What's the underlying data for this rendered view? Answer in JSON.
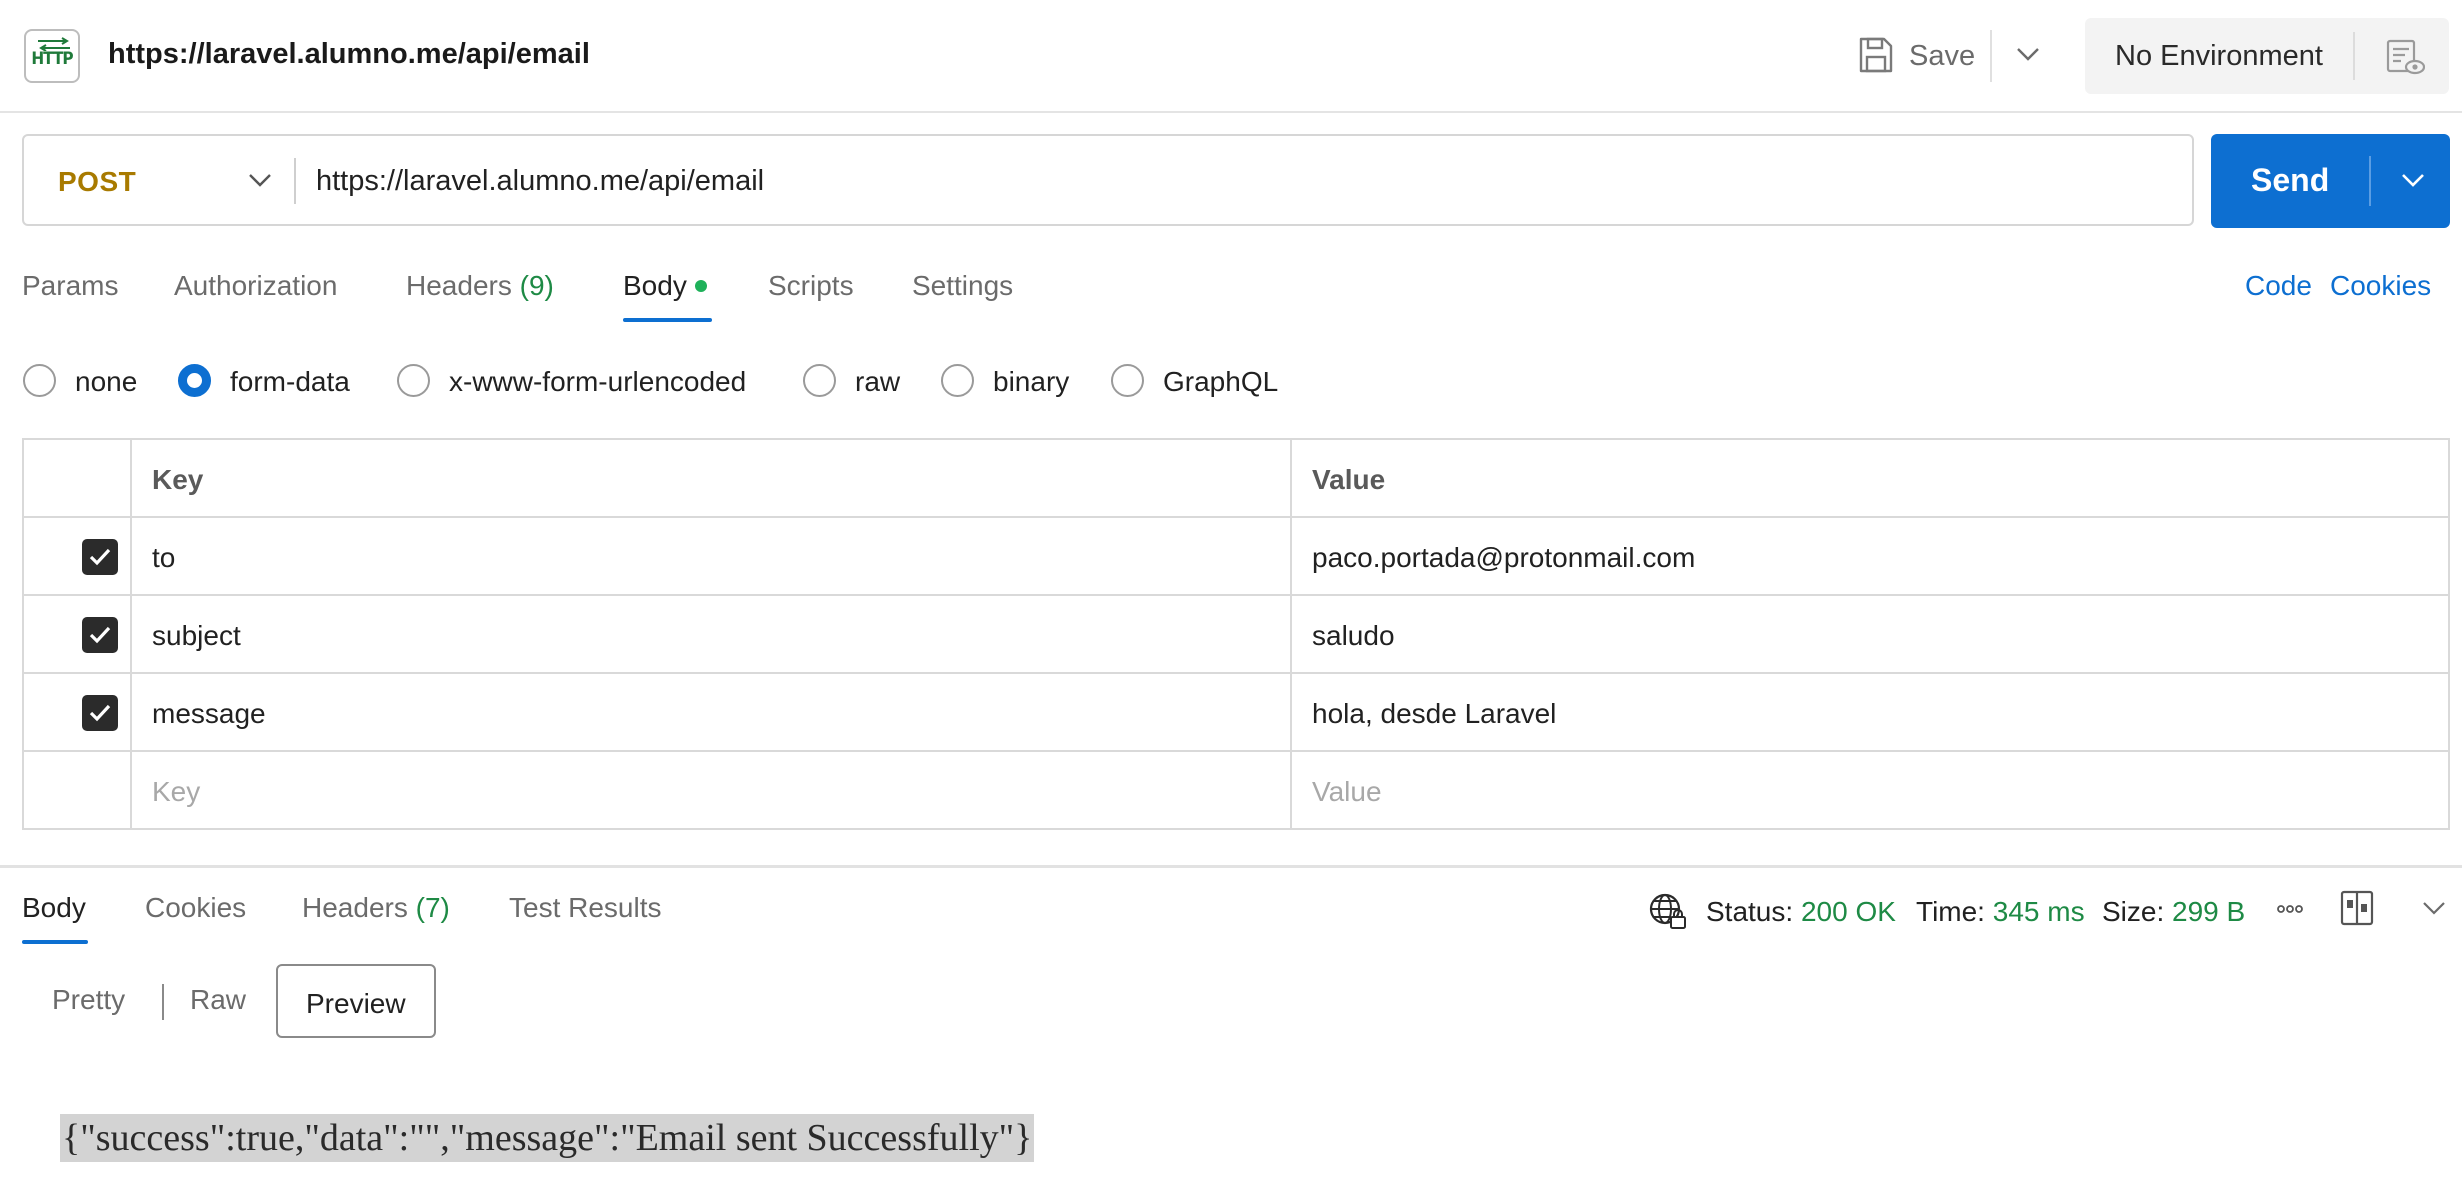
{
  "header": {
    "badge_text": "HTTP",
    "title": "https://laravel.alumno.me/api/email",
    "save_label": "Save",
    "environment": "No Environment",
    "icons": [
      "http-arrows-icon",
      "save-icon",
      "chevron-down-icon",
      "environment-eye-icon"
    ]
  },
  "request": {
    "method": "POST",
    "url": "https://laravel.alumno.me/api/email",
    "send_label": "Send"
  },
  "request_tabs": [
    {
      "label": "Params",
      "count": ""
    },
    {
      "label": "Authorization",
      "count": ""
    },
    {
      "label": "Headers",
      "count": "(9)"
    },
    {
      "label": "Body",
      "count": "",
      "active": true
    },
    {
      "label": "Scripts",
      "count": ""
    },
    {
      "label": "Settings",
      "count": ""
    }
  ],
  "links": {
    "code": "Code",
    "cookies": "Cookies"
  },
  "body_types": [
    {
      "label": "none",
      "selected": false
    },
    {
      "label": "form-data",
      "selected": true
    },
    {
      "label": "x-www-form-urlencoded",
      "selected": false
    },
    {
      "label": "raw",
      "selected": false
    },
    {
      "label": "binary",
      "selected": false
    },
    {
      "label": "GraphQL",
      "selected": false
    }
  ],
  "form_table": {
    "headers": {
      "key": "Key",
      "value": "Value"
    },
    "rows": [
      {
        "checked": true,
        "key": "to",
        "value": "paco.portada@protonmail.com"
      },
      {
        "checked": true,
        "key": "subject",
        "value": "saludo"
      },
      {
        "checked": true,
        "key": "message",
        "value": "hola, desde Laravel"
      }
    ],
    "placeholder": {
      "key": "Key",
      "value": "Value"
    }
  },
  "response_tabs": [
    {
      "label": "Body",
      "count": "",
      "active": true
    },
    {
      "label": "Cookies",
      "count": ""
    },
    {
      "label": "Headers",
      "count": "(7)"
    },
    {
      "label": "Test Results",
      "count": ""
    }
  ],
  "response_stats": {
    "status_label": "Status:",
    "status": "200 OK",
    "time_label": "Time:",
    "time": "345 ms",
    "size_label": "Size:",
    "size": "299 B"
  },
  "view_modes": {
    "pretty": "Pretty",
    "raw": "Raw",
    "preview": "Preview",
    "selected": "Preview"
  },
  "response_body": "{\"success\":true,\"data\":\"\",\"message\":\"Email sent Successfully\"}",
  "colors": {
    "accent": "#0d6fd1",
    "method": "#a87a00",
    "success": "#1e8a45"
  }
}
